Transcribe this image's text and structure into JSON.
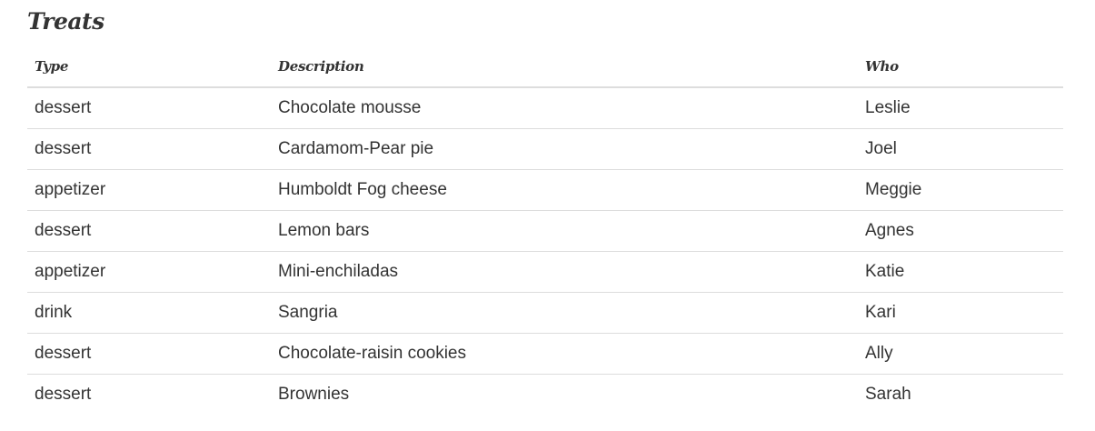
{
  "section": {
    "title": "Treats"
  },
  "table": {
    "headers": {
      "type": "Type",
      "description": "Description",
      "who": "Who"
    },
    "rows": [
      {
        "type": "dessert",
        "description": "Chocolate mousse",
        "who": "Leslie"
      },
      {
        "type": "dessert",
        "description": "Cardamom-Pear pie",
        "who": "Joel"
      },
      {
        "type": "appetizer",
        "description": "Humboldt Fog cheese",
        "who": "Meggie"
      },
      {
        "type": "dessert",
        "description": "Lemon bars",
        "who": "Agnes"
      },
      {
        "type": "appetizer",
        "description": "Mini-enchiladas",
        "who": "Katie"
      },
      {
        "type": "drink",
        "description": "Sangria",
        "who": "Kari"
      },
      {
        "type": "dessert",
        "description": "Chocolate-raisin cookies",
        "who": "Ally"
      },
      {
        "type": "dessert",
        "description": "Brownies",
        "who": "Sarah"
      }
    ]
  }
}
